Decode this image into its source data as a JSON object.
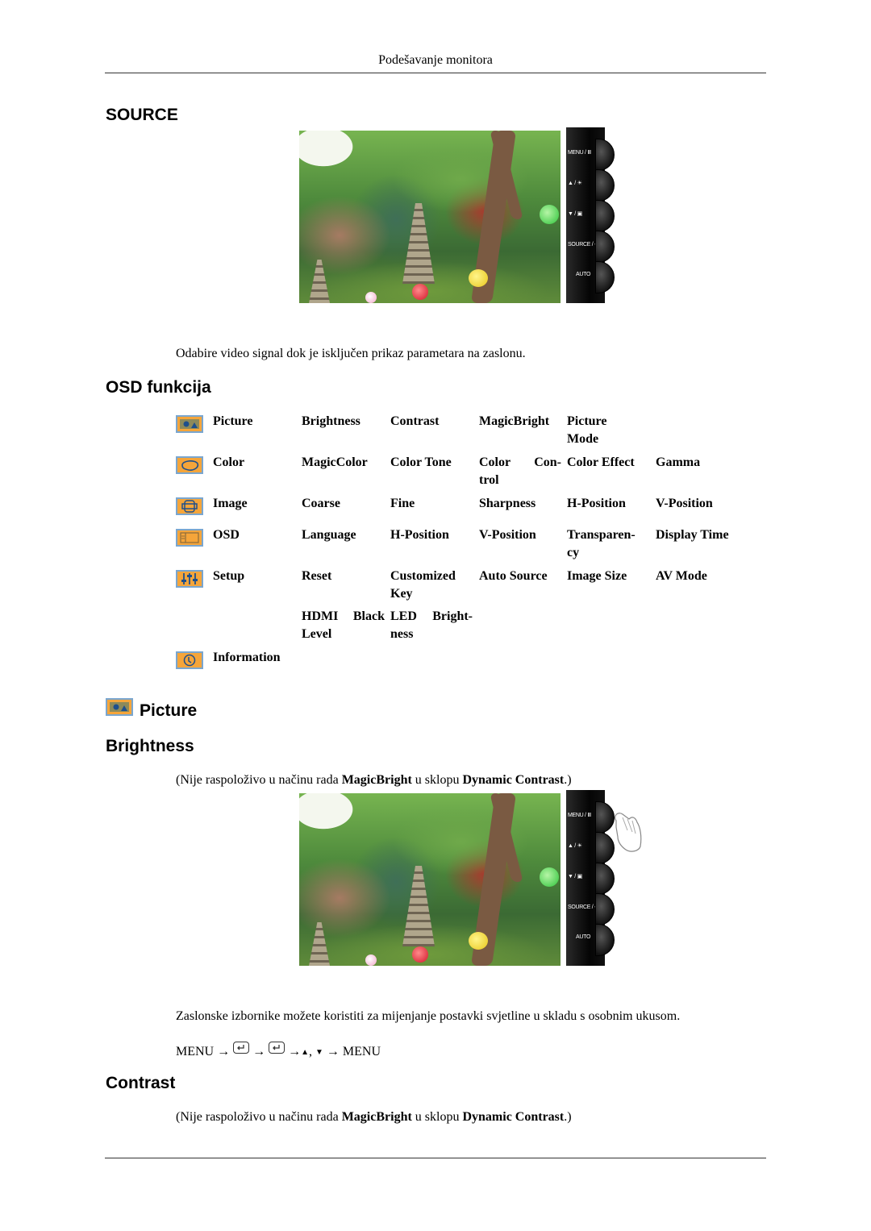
{
  "header": {
    "title": "Podešavanje monitora"
  },
  "source_section": {
    "heading": "SOURCE",
    "description": "Odabire video signal dok je isključen prikaz parametara na zaslonu."
  },
  "control_panel": {
    "buttons": [
      {
        "label": "MENU / Ⅲ",
        "icon": "menu-icon"
      },
      {
        "label": "▲ / ☀",
        "icon": "up-brightness-icon"
      },
      {
        "label": "▼ / ▣",
        "icon": "down-icon"
      },
      {
        "label": "SOURCE / ↵",
        "icon": "source-enter-icon"
      },
      {
        "label": "AUTO",
        "icon": "auto-icon"
      }
    ]
  },
  "osd_section": {
    "heading": "OSD funkcija",
    "rows": [
      {
        "icon": "picture-icon",
        "menu": "Picture",
        "items": [
          "Brightness",
          "Contrast",
          "MagicBright",
          "Picture Mode",
          ""
        ]
      },
      {
        "icon": "color-icon",
        "menu": "Color",
        "items": [
          "MagicColor",
          "Color Tone",
          "Color Con-trol",
          "Color Effect",
          "Gamma"
        ]
      },
      {
        "icon": "image-icon",
        "menu": "Image",
        "items": [
          "Coarse",
          "Fine",
          "Sharpness",
          "H-Position",
          "V-Position"
        ]
      },
      {
        "icon": "osd-icon",
        "menu": "OSD",
        "items": [
          "Language",
          "H-Position",
          "V-Position",
          "Transparen-cy",
          "Display Time"
        ]
      },
      {
        "icon": "setup-icon",
        "menu": "Setup",
        "items": [
          "Reset",
          "Customized Key",
          "Auto Source",
          "Image Size",
          "AV Mode"
        ]
      },
      {
        "icon": "",
        "menu": "",
        "items": [
          "HDMI Black Level",
          "LED Bright-ness",
          "",
          "",
          ""
        ]
      },
      {
        "icon": "information-icon",
        "menu": "Information",
        "items": [
          "",
          "",
          "",
          "",
          ""
        ]
      }
    ],
    "cells": {
      "r0": [
        "Picture",
        "Brightness",
        "Contrast",
        "MagicBright",
        "Picture",
        "Mode",
        ""
      ],
      "r1": [
        "Color",
        "MagicColor",
        "Color Tone",
        "Color",
        "Con-",
        "trol",
        "Color Effect",
        "Gamma"
      ],
      "r2": [
        "Image",
        "Coarse",
        "Fine",
        "Sharpness",
        "H-Position",
        "V-Position"
      ],
      "r3": [
        "OSD",
        "Language",
        "H-Position",
        "V-Position",
        "Transparen-",
        "cy",
        "Display Time"
      ],
      "r4": [
        "Setup",
        "Reset",
        "Customized",
        "Key",
        "Auto Source",
        "Image Size",
        "AV Mode"
      ],
      "r5": [
        "HDMI",
        "Black",
        "Level",
        "LED",
        "Bright-",
        "ness"
      ],
      "r6": [
        "Information"
      ]
    }
  },
  "picture_section": {
    "heading": "Picture"
  },
  "brightness_section": {
    "heading": "Brightness",
    "note_prefix": "(Nije raspoloživo u načinu rada ",
    "note_bold1": "MagicBright",
    "note_mid": " u sklopu ",
    "note_bold2": "Dynamic Contrast",
    "note_suffix": ".)",
    "description": "Zaslonske izbornike možete koristiti za mijenjanje postavki svjetline u skladu s osobnim ukusom.",
    "nav": {
      "start": "MENU",
      "arrow": "→",
      "up": "▲",
      "comma": ",",
      "down": "▼",
      "end": "MENU"
    }
  },
  "contrast_section": {
    "heading": "Contrast",
    "note_prefix": "(Nije raspoloživo u načinu rada ",
    "note_bold1": "MagicBright",
    "note_mid": " u sklopu ",
    "note_bold2": "Dynamic Contrast",
    "note_suffix": ".)"
  }
}
